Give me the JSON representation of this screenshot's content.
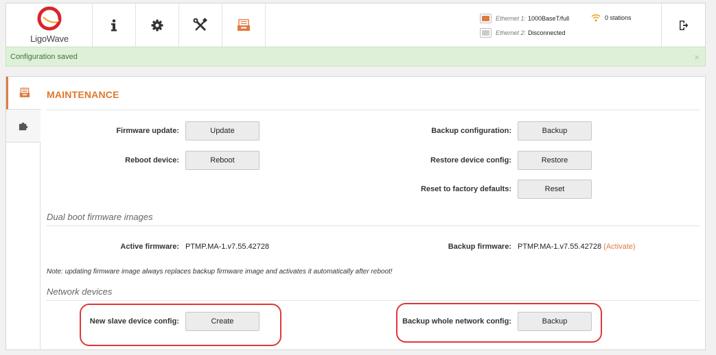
{
  "header": {
    "logo_text": "LigoWave",
    "nav": [
      {
        "icon": "info-icon"
      },
      {
        "icon": "gear-icon"
      },
      {
        "icon": "tools-icon"
      },
      {
        "icon": "maintenance-icon"
      }
    ],
    "ethernet1": {
      "label": "Ethernet 1:",
      "value": "1000BaseT/full"
    },
    "ethernet2": {
      "label": "Ethernet 2:",
      "value": "Disconnected"
    },
    "stations": "0 stations"
  },
  "alert": {
    "text": "Configuration saved",
    "close": "×"
  },
  "maintenance": {
    "title": "MAINTENANCE",
    "firmware_update_label": "Firmware update:",
    "firmware_update_button": "Update",
    "reboot_label": "Reboot device:",
    "reboot_button": "Reboot",
    "backup_config_label": "Backup configuration:",
    "backup_config_button": "Backup",
    "restore_label": "Restore device config:",
    "restore_button": "Restore",
    "reset_label": "Reset to factory defaults:",
    "reset_button": "Reset"
  },
  "dual_boot": {
    "section_title": "Dual boot firmware images",
    "active_label": "Active firmware:",
    "active_value": "PTMP.MA-1.v7.55.42728",
    "backup_label": "Backup firmware:",
    "backup_value": "PTMP.MA-1.v7.55.42728",
    "activate_link": "(Activate)",
    "note": "Note: updating firmware image always replaces backup firmware image and activates it automatically after reboot!"
  },
  "network_devices": {
    "section_title": "Network devices",
    "slave_label": "New slave device config:",
    "slave_button": "Create",
    "backup_network_label": "Backup whole network config:",
    "backup_network_button": "Backup"
  },
  "colors": {
    "accent": "#e07a3e",
    "alert_bg": "#dff0d8",
    "alert_text": "#3c763d",
    "highlight": "#e0373a"
  }
}
